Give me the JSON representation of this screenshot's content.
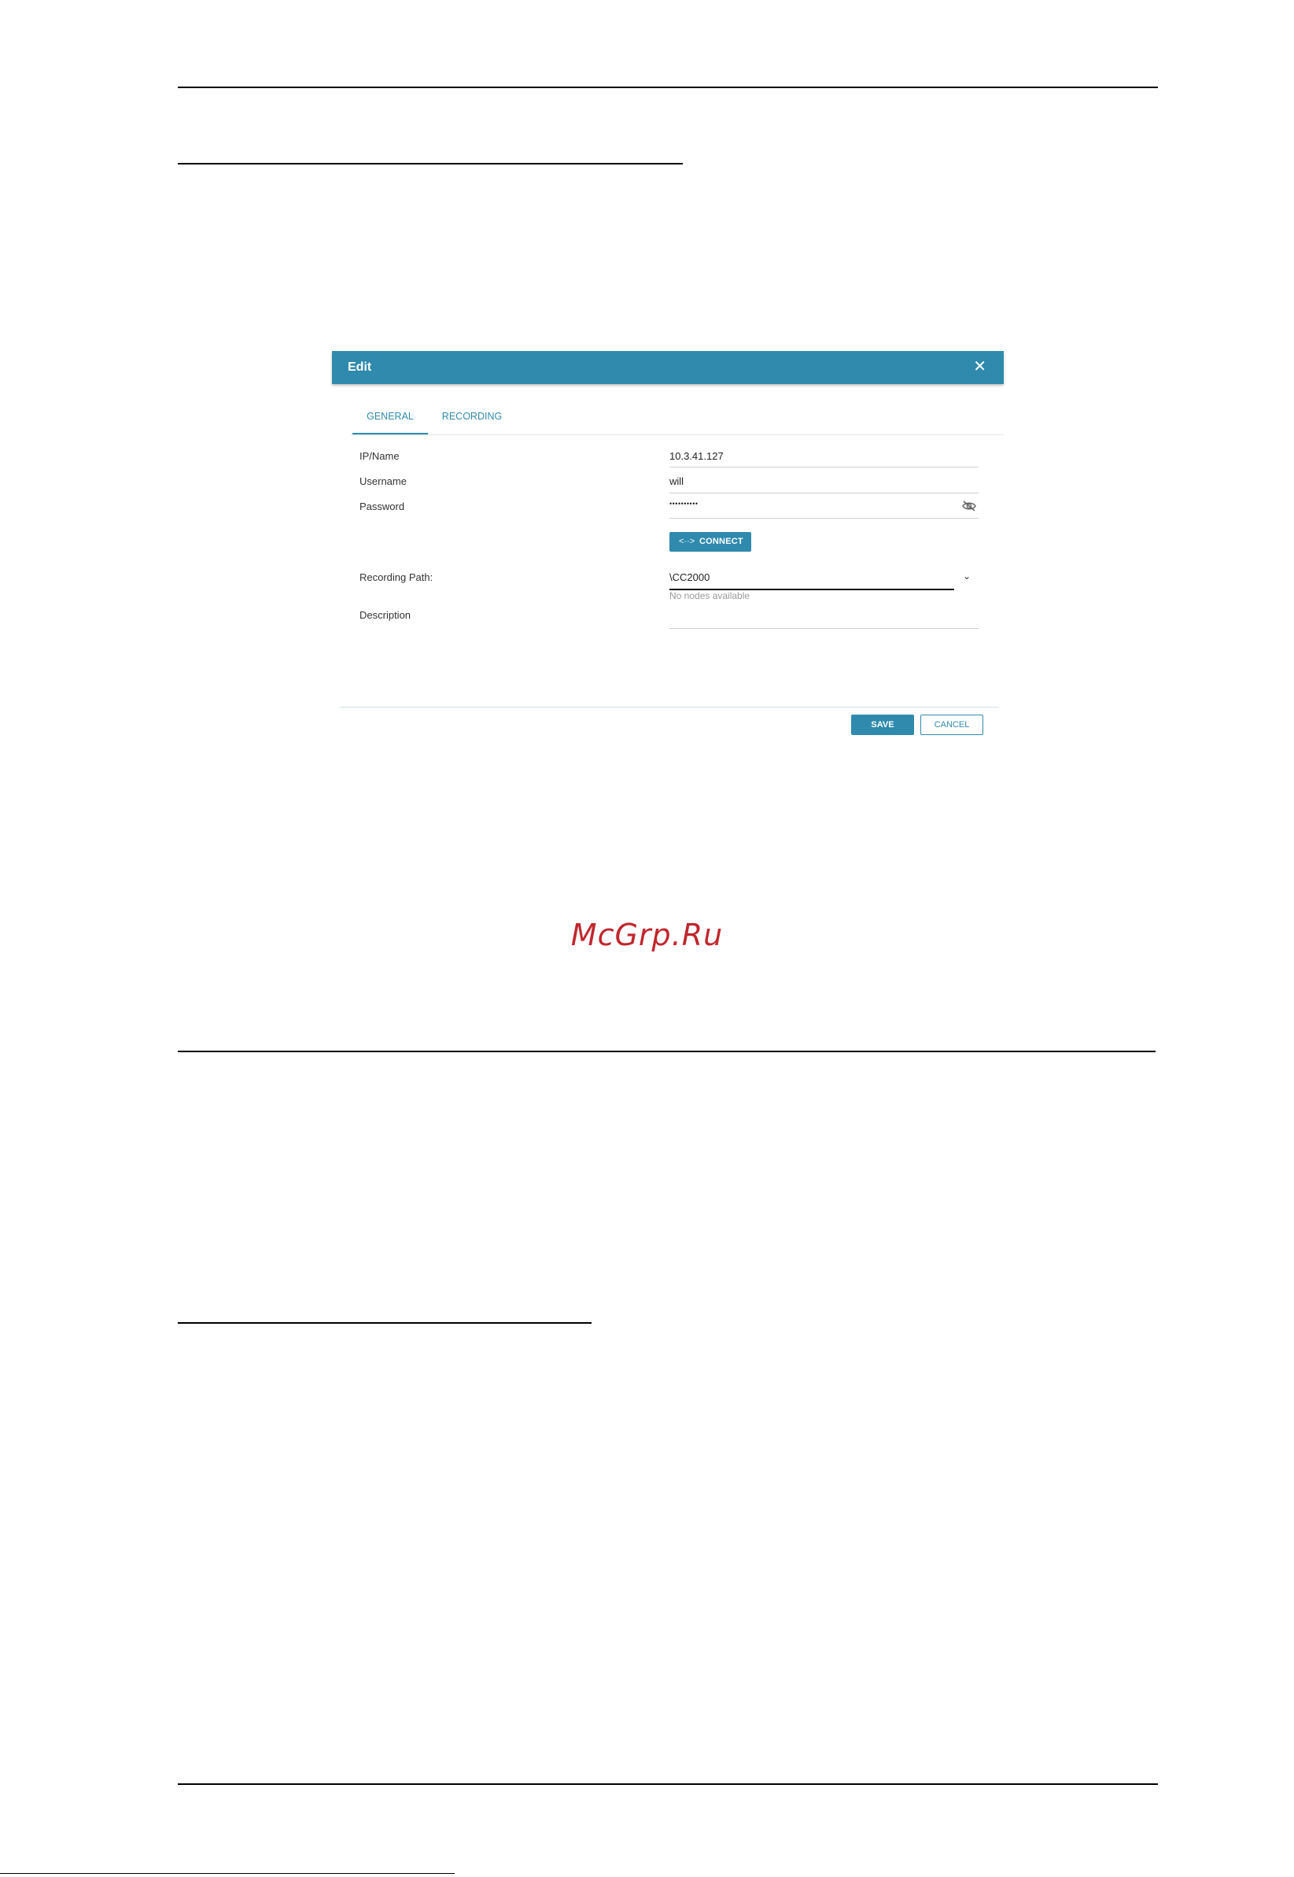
{
  "dialog": {
    "title": "Edit",
    "close_glyph": "✕",
    "tabs": [
      {
        "label": "GENERAL",
        "active": true
      },
      {
        "label": "RECORDING",
        "active": false
      }
    ],
    "fields": {
      "ip_name": {
        "label": "IP/Name",
        "value": "10.3.41.127"
      },
      "username": {
        "label": "Username",
        "value": "will"
      },
      "password": {
        "label": "Password",
        "value": "••••••••••",
        "visibility_icon": "eye-off-icon"
      },
      "recording_path": {
        "label": "Recording Path:",
        "value": "\\CC2000",
        "hint": "No nodes available",
        "icon": "chevron-down-icon"
      },
      "description": {
        "label": "Description",
        "value": ""
      }
    },
    "connect_button": {
      "icon_glyph": "<··>",
      "label": "CONNECT"
    },
    "save_button": "SAVE",
    "cancel_button": "CANCEL"
  },
  "watermark": "McGrp.Ru",
  "footnote": "",
  "colors": {
    "accent": "#2f8aad",
    "watermark": "#c0272d"
  }
}
